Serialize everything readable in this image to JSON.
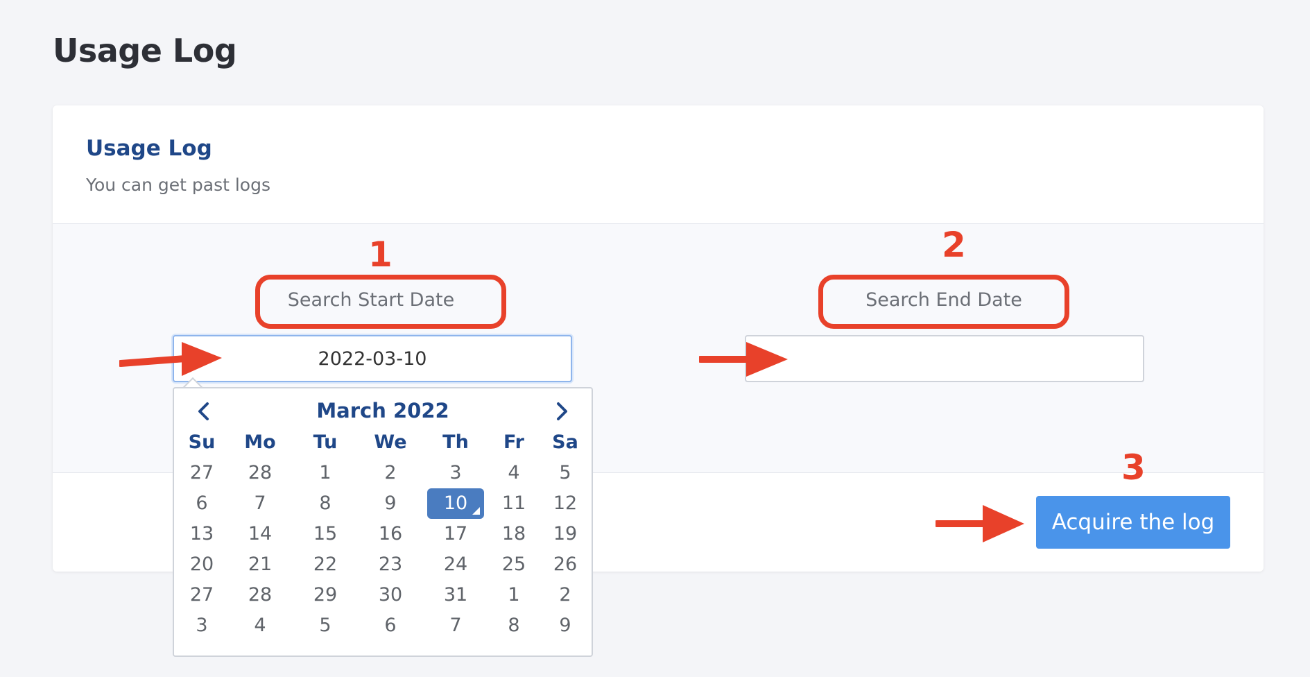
{
  "page": {
    "title": "Usage Log"
  },
  "card": {
    "title": "Usage Log",
    "subtitle": "You can get past logs",
    "start_label": "Search Start Date",
    "start_value": "2022-03-10",
    "end_label": "Search End Date",
    "end_value": "",
    "submit_label": "Acquire the log"
  },
  "annotations": {
    "one": "1",
    "two": "2",
    "three": "3",
    "color": "#e8412a"
  },
  "datepicker": {
    "month_label": "March 2022",
    "weekdays": [
      "Su",
      "Mo",
      "Tu",
      "We",
      "Th",
      "Fr",
      "Sa"
    ],
    "weeks": [
      [
        "27",
        "28",
        "1",
        "2",
        "3",
        "4",
        "5"
      ],
      [
        "6",
        "7",
        "8",
        "9",
        "10",
        "11",
        "12"
      ],
      [
        "13",
        "14",
        "15",
        "16",
        "17",
        "18",
        "19"
      ],
      [
        "20",
        "21",
        "22",
        "23",
        "24",
        "25",
        "26"
      ],
      [
        "27",
        "28",
        "29",
        "30",
        "31",
        "1",
        "2"
      ],
      [
        "3",
        "4",
        "5",
        "6",
        "7",
        "8",
        "9"
      ]
    ],
    "selected_day": "10",
    "prev_icon": "chevron-left-icon",
    "next_icon": "chevron-right-icon"
  },
  "colors": {
    "primary": "#4a94ea",
    "heading": "#1f4788",
    "selected": "#4a7cc0"
  }
}
